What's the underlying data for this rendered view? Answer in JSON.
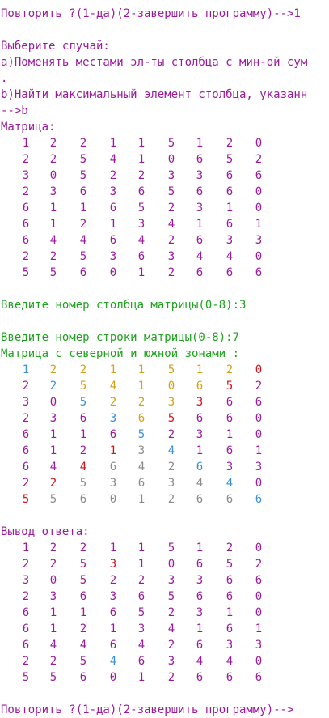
{
  "prompt_top": "Повторить ?(1-да)(2-завершить программу)-->1",
  "choose": "Выберите случай:",
  "option_a": "a)Поменять местами эл-ты столбца с мин-ой сум",
  "dot": ".",
  "option_b": "b)Найти максимальный элемент столбца, указанн",
  "answer_b": "-->b",
  "matrix_label": "Матрица:",
  "matrix": [
    [
      "1",
      "2",
      "2",
      "1",
      "1",
      "5",
      "1",
      "2",
      "0"
    ],
    [
      "2",
      "2",
      "5",
      "4",
      "1",
      "0",
      "6",
      "5",
      "2"
    ],
    [
      "3",
      "0",
      "5",
      "2",
      "2",
      "3",
      "3",
      "6",
      "6"
    ],
    [
      "2",
      "3",
      "6",
      "3",
      "6",
      "5",
      "6",
      "6",
      "0"
    ],
    [
      "6",
      "1",
      "1",
      "6",
      "5",
      "2",
      "3",
      "1",
      "0"
    ],
    [
      "6",
      "1",
      "2",
      "1",
      "3",
      "4",
      "1",
      "6",
      "1"
    ],
    [
      "6",
      "4",
      "4",
      "6",
      "4",
      "2",
      "6",
      "3",
      "3"
    ],
    [
      "2",
      "2",
      "5",
      "3",
      "6",
      "3",
      "4",
      "4",
      "0"
    ],
    [
      "5",
      "5",
      "6",
      "0",
      "1",
      "2",
      "6",
      "6",
      "6"
    ]
  ],
  "col_prompt": "Введите номер столбца матрицы(0-8):3",
  "row_prompt": "Введите номер строки матрицы(0-8):7",
  "zones_label": "Матрица с северной и южной зонами :",
  "zone_colors": [
    [
      "b",
      "y",
      "y",
      "y",
      "y",
      "y",
      "y",
      "y",
      "r"
    ],
    [
      "m",
      "b",
      "y",
      "y",
      "y",
      "y",
      "y",
      "r",
      "m"
    ],
    [
      "m",
      "m",
      "b",
      "y",
      "y",
      "y",
      "r",
      "m",
      "m"
    ],
    [
      "m",
      "m",
      "m",
      "b",
      "y",
      "r",
      "m",
      "m",
      "m"
    ],
    [
      "m",
      "m",
      "m",
      "m",
      "b",
      "m",
      "m",
      "m",
      "m"
    ],
    [
      "m",
      "m",
      "m",
      "r",
      "g",
      "b",
      "m",
      "m",
      "m"
    ],
    [
      "m",
      "m",
      "r",
      "g",
      "g",
      "g",
      "b",
      "m",
      "m"
    ],
    [
      "m",
      "r",
      "g",
      "g",
      "g",
      "g",
      "g",
      "b",
      "m"
    ],
    [
      "r",
      "g",
      "g",
      "g",
      "g",
      "g",
      "g",
      "g",
      "b"
    ]
  ],
  "output_label": "Вывод ответа:",
  "result": [
    [
      "1",
      "2",
      "2",
      "1",
      "1",
      "5",
      "1",
      "2",
      "0"
    ],
    [
      "2",
      "2",
      "5",
      "3",
      "1",
      "0",
      "6",
      "5",
      "2"
    ],
    [
      "3",
      "0",
      "5",
      "2",
      "2",
      "3",
      "3",
      "6",
      "6"
    ],
    [
      "2",
      "3",
      "6",
      "3",
      "6",
      "5",
      "6",
      "6",
      "0"
    ],
    [
      "6",
      "1",
      "1",
      "6",
      "5",
      "2",
      "3",
      "1",
      "0"
    ],
    [
      "6",
      "1",
      "2",
      "1",
      "3",
      "4",
      "1",
      "6",
      "1"
    ],
    [
      "6",
      "4",
      "4",
      "6",
      "4",
      "2",
      "6",
      "3",
      "3"
    ],
    [
      "2",
      "2",
      "5",
      "4",
      "6",
      "3",
      "4",
      "4",
      "0"
    ],
    [
      "5",
      "5",
      "6",
      "0",
      "1",
      "2",
      "6",
      "6",
      "6"
    ]
  ],
  "result_colors": [
    [
      "m",
      "m",
      "m",
      "m",
      "m",
      "m",
      "m",
      "m",
      "m"
    ],
    [
      "m",
      "m",
      "m",
      "r",
      "m",
      "m",
      "m",
      "m",
      "m"
    ],
    [
      "m",
      "m",
      "m",
      "m",
      "m",
      "m",
      "m",
      "m",
      "m"
    ],
    [
      "m",
      "m",
      "m",
      "m",
      "m",
      "m",
      "m",
      "m",
      "m"
    ],
    [
      "m",
      "m",
      "m",
      "m",
      "m",
      "m",
      "m",
      "m",
      "m"
    ],
    [
      "m",
      "m",
      "m",
      "m",
      "m",
      "m",
      "m",
      "m",
      "m"
    ],
    [
      "m",
      "m",
      "m",
      "m",
      "m",
      "m",
      "m",
      "m",
      "m"
    ],
    [
      "m",
      "m",
      "m",
      "b",
      "m",
      "m",
      "m",
      "m",
      "m"
    ],
    [
      "m",
      "m",
      "m",
      "m",
      "m",
      "m",
      "m",
      "m",
      "m"
    ]
  ],
  "prompt_bottom": "Повторить ?(1-да)(2-завершить программу)-->",
  "colors": {
    "magenta": "#9b1a9b",
    "green": "#1ea21e",
    "blue": "#3b8fd9",
    "yellow": "#d4a017",
    "red": "#d1121a",
    "gray": "#8a8a8a"
  }
}
